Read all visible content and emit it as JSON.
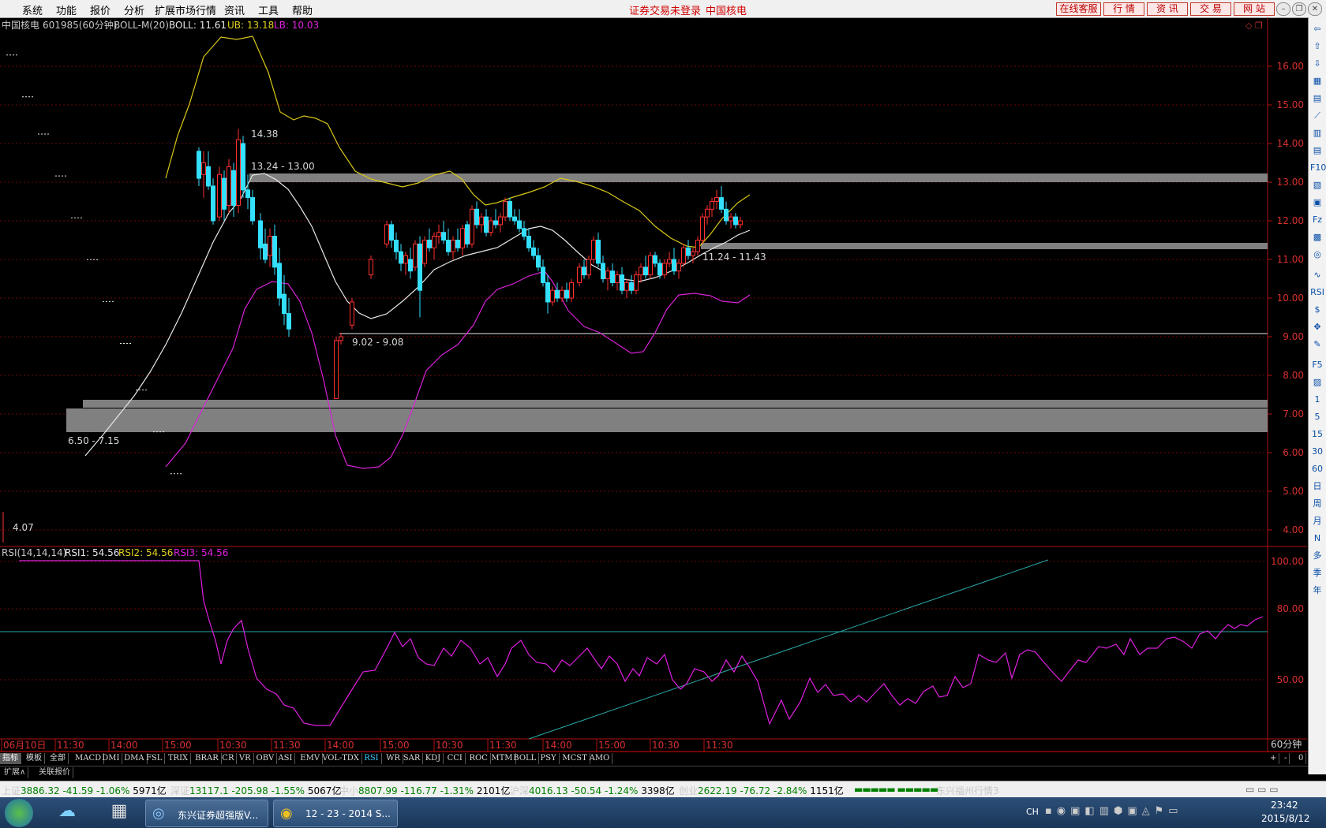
{
  "menu": {
    "items": [
      "系统",
      "功能",
      "报价",
      "分析",
      "扩展市场行情",
      "资讯",
      "工具",
      "帮助"
    ],
    "notice": "证券交易未登录",
    "stock_name": "中国核电",
    "right_buttons": [
      "在线客服",
      "行 情",
      "资 讯",
      "交 易",
      "网 站"
    ]
  },
  "main_panel": {
    "header": {
      "stock": "中国核电",
      "code_period": "601985(60分钟)",
      "indicator": "BOLL-M(20)",
      "boll": "BOLL: 11.61",
      "ub": "UB: 13.18",
      "lb": "LB: 10.03"
    },
    "price_axis": [
      "16.00",
      "15.00",
      "14.00",
      "13.00",
      "12.00",
      "11.00",
      "10.00",
      "9.00",
      "8.00",
      "7.00",
      "6.00",
      "5.00",
      "4.00"
    ],
    "annotations": {
      "high": "14.38",
      "low": "4.07",
      "zone1": "13.24 - 13.00",
      "zone2": "11.24 - 11.43",
      "zone3": "9.02 - 9.08",
      "zone4": "6.50 - 7.15"
    }
  },
  "rsi_panel": {
    "title": "RSI(14,14,14)",
    "rsi1": "RSI1: 54.56",
    "rsi2": "RSI2: 54.56",
    "rsi3": "RSI3: 54.56",
    "axis": [
      "100.00",
      "80.00",
      "50.00"
    ]
  },
  "time_axis": [
    "06月10日",
    "11:30",
    "14:00",
    "15:00",
    "10:30",
    "11:30",
    "14:00",
    "15:00",
    "10:30",
    "11:30",
    "14:00",
    "15:00",
    "10:30",
    "11:30"
  ],
  "period_label": "60分钟",
  "tabs": {
    "left": [
      "指标",
      "模板",
      "全部"
    ],
    "indicators": [
      "MACD",
      "DMI",
      "DMA",
      "FSL",
      "TRIX",
      "BRAR",
      "CR",
      "VR",
      "OBV",
      "ASI",
      "EMV",
      "VOL-TDX",
      "RSI",
      "WR",
      "SAR",
      "KDJ",
      "CCI",
      "ROC",
      "MTM",
      "BOLL",
      "PSY",
      "MCST",
      "AMO"
    ],
    "right": [
      "+",
      "-",
      "0"
    ],
    "ext": [
      "扩展∧",
      "关联报价"
    ]
  },
  "status": {
    "sh": {
      "name": "上证",
      "value": "3886.32",
      "chg": "-41.59",
      "pct": "-1.06%",
      "amt": "5971亿"
    },
    "sz": {
      "name": "深证",
      "value": "13117.1",
      "chg": "-205.98",
      "pct": "-1.55%",
      "amt": "5067亿"
    },
    "zx": {
      "name": "中小",
      "value": "8807.99",
      "chg": "-116.77",
      "pct": "-1.31%",
      "amt": "2101亿"
    },
    "hs": {
      "name": "沪深",
      "value": "4016.13",
      "chg": "-50.54",
      "pct": "-1.24%",
      "amt": "3398亿"
    },
    "cy": {
      "name": "创业",
      "value": "2622.19",
      "chg": "-76.72",
      "pct": "-2.84%",
      "amt": "1151亿"
    },
    "server": "东兴福州行情3"
  },
  "right_toolbar": [
    "1",
    "5",
    "15",
    "30",
    "60",
    "日",
    "周",
    "月",
    "N",
    "多",
    "季",
    "年"
  ],
  "taskbar": {
    "task1": "东兴证券超强版V...",
    "task2": "12 - 23 - 2014 S...",
    "lang": "CH",
    "time": "23:42",
    "date": "2015/8/12"
  },
  "colors": {
    "up": "#ff3030",
    "down": "#33e0ff",
    "ub": "#e0d020",
    "lb": "#e020e0",
    "mid": "#e8e8e8",
    "zone": "#7a7a7a"
  }
}
